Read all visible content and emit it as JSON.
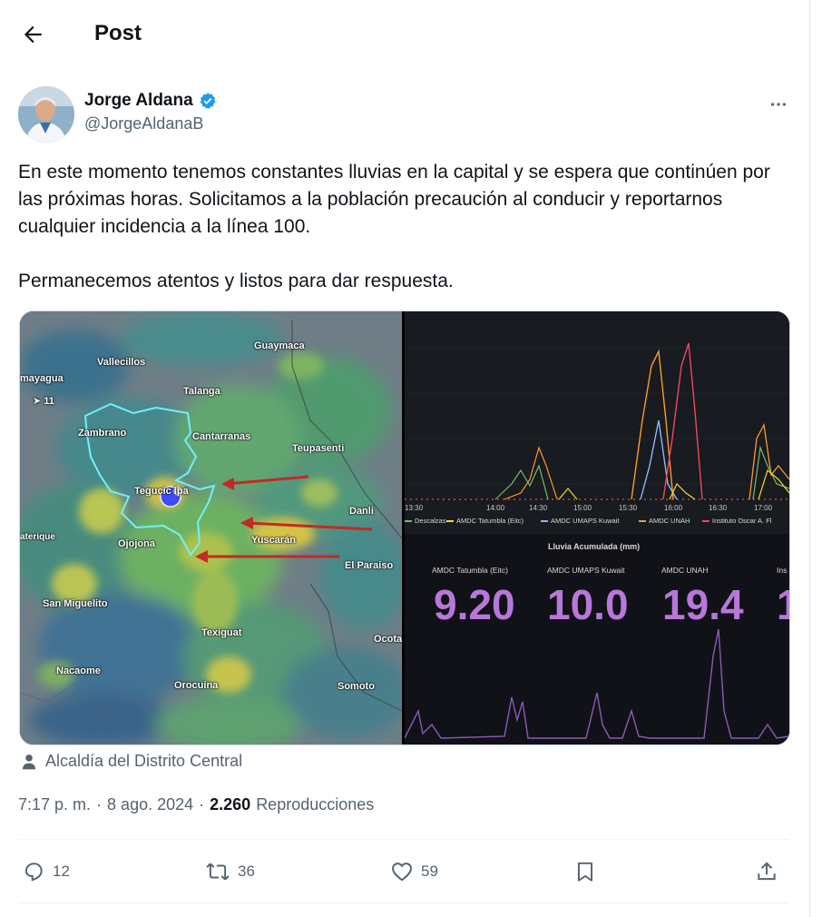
{
  "header": {
    "title": "Post"
  },
  "post": {
    "author_name": "Jorge Aldana",
    "author_handle": "@JorgeAldanaB",
    "paragraphs": [
      "En este momento tenemos constantes lluvias en la capital y se espera que continúen por las próximas horas. Solicitamos a la población precaución al conducir y reportarnos cualquier incidencia a la línea 100.",
      "Permanecemos atentos y listos para dar respuesta."
    ],
    "attribution": "Alcaldía del Distrito Central",
    "time": "7:17 p. m.",
    "date": "8 ago. 2024",
    "views_count": "2.260",
    "views_label": "Reproducciones"
  },
  "map": {
    "labels": {
      "guaymaca": "Guaymaca",
      "vallecillos": "Vallecillos",
      "comayagua": "mayagua",
      "wind": "11",
      "talanga": "Talanga",
      "zambrano": "Zambrano",
      "cantarranas": "Cantarranas",
      "teupasenti": "Teupasenti",
      "tegucigalpa": "Tegucic   lpa",
      "danli": "Danli",
      "lepaterique": "aterique",
      "ojojona": "Ojojona",
      "yuscaran": "Yuscarán",
      "el_paraiso": "El Paraiso",
      "san_miguelito": "San Miguelito",
      "texiguat": "Texiguat",
      "ocotal": "Ocota",
      "nacaome": "Nacaome",
      "orocuina": "Orocuina",
      "somoto": "Somoto"
    }
  },
  "chart": {
    "x_ticks": [
      "13:30",
      "14:00",
      "14:30",
      "15:00",
      "15:30",
      "16:00",
      "16:30",
      "17:00"
    ],
    "legend": [
      {
        "name": "Descalzas",
        "color": "#73bf69"
      },
      {
        "name": "AMDC Tatumbla (Eitc)",
        "color": "#fade2a"
      },
      {
        "name": "AMDC UMAPS Kuwait",
        "color": "#8ab8ff"
      },
      {
        "name": "AMDC UNAH",
        "color": "#ff9830"
      },
      {
        "name": "Instituto Oscar A. Fl",
        "color": "#f2495c"
      }
    ],
    "panel_title": "Lluvia Acumulada (mm)",
    "stats": [
      {
        "label": "AMDC Tatumbla (Eitc)",
        "value": "9.20"
      },
      {
        "label": "AMDC UMAPS Kuwait",
        "value": "10.0"
      },
      {
        "label": "AMDC UNAH",
        "value": "19.4"
      },
      {
        "label": "Ins",
        "value": "1"
      }
    ]
  },
  "actions": {
    "replies": "12",
    "reposts": "36",
    "likes": "59"
  },
  "colors": {
    "accent": "#1d9bf0",
    "muted": "#536471",
    "text": "#0f1419"
  }
}
